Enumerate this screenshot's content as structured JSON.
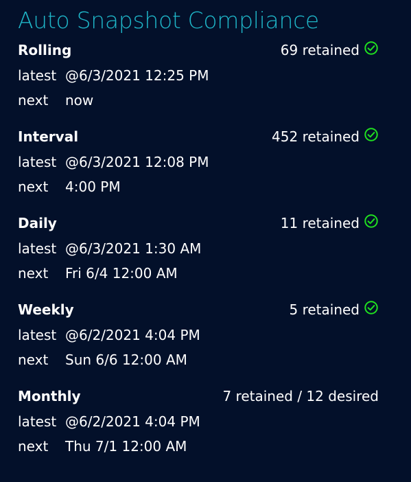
{
  "title": "Auto Snapshot Compliance",
  "colors": {
    "background": "#03102a",
    "title": "#1fb6c8",
    "text": "#ffffff",
    "check": "#20e020"
  },
  "sections": [
    {
      "name": "Rolling",
      "retained": "69 retained",
      "compliant": true,
      "latest_label": "latest",
      "latest": "@6/3/2021 12:25 PM",
      "next_label": "next",
      "next": "now"
    },
    {
      "name": "Interval",
      "retained": "452 retained",
      "compliant": true,
      "latest_label": "latest",
      "latest": "@6/3/2021 12:08 PM",
      "next_label": "next",
      "next": "4:00 PM"
    },
    {
      "name": "Daily",
      "retained": "11 retained",
      "compliant": true,
      "latest_label": "latest",
      "latest": "@6/3/2021 1:30 AM",
      "next_label": "next",
      "next": "Fri 6/4 12:00 AM"
    },
    {
      "name": "Weekly",
      "retained": "5 retained",
      "compliant": true,
      "latest_label": "latest",
      "latest": "@6/2/2021 4:04 PM",
      "next_label": "next",
      "next": "Sun 6/6 12:00 AM"
    },
    {
      "name": "Monthly",
      "retained": "7 retained / 12 desired",
      "compliant": false,
      "latest_label": "latest",
      "latest": "@6/2/2021 4:04 PM",
      "next_label": "next",
      "next": "Thu 7/1 12:00 AM"
    }
  ]
}
